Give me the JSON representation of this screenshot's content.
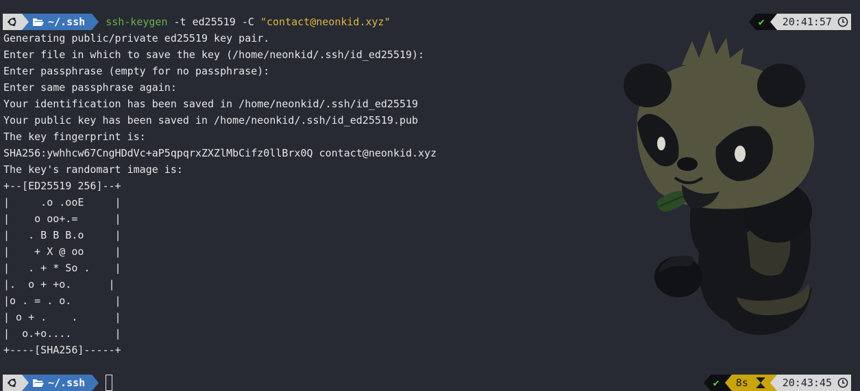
{
  "prompt": {
    "os_icon": "ubuntu-icon",
    "folder_icon": "folder-open-icon",
    "dir": "~/.ssh"
  },
  "command": {
    "name": "ssh-keygen",
    "args": "-t ed25519 -C",
    "quoted": "\"contact@neonkid.xyz\""
  },
  "output": [
    "Generating public/private ed25519 key pair.",
    "Enter file in which to save the key (/home/neonkid/.ssh/id_ed25519):",
    "Enter passphrase (empty for no passphrase):",
    "Enter same passphrase again:",
    "Your identification has been saved in /home/neonkid/.ssh/id_ed25519",
    "Your public key has been saved in /home/neonkid/.ssh/id_ed25519.pub",
    "The key fingerprint is:",
    "SHA256:ywhhcw67CngHDdVc+aP5qpqrxZXZlMbCifz0llBrx0Q contact@neonkid.xyz",
    "The key's randomart image is:",
    "+--[ED25519 256]--+",
    "|     .o .ooE     |",
    "|    o oo+.=      |",
    "|   . B B B.o     |",
    "|    + X @ oo     |",
    "|   . + * So .    |",
    "|.  o + +o.      |",
    "|o . = . o.       |",
    "| o + .    .      |",
    "|  o.+o....       |",
    "+----[SHA256]-----+"
  ],
  "status_top": {
    "check": "✔",
    "time": "20:41:57",
    "clock_icon": "clock-icon"
  },
  "status_bottom": {
    "check": "✔",
    "duration": "8s",
    "hourglass_icon": "hourglass-icon",
    "time": "20:43:45",
    "clock_icon": "clock-icon"
  },
  "colors": {
    "background": "#282a33",
    "dir_segment": "#3c74b9",
    "duration_segment": "#c9a40d",
    "command_green": "#6ab04c",
    "string_yellow": "#d9b740"
  }
}
